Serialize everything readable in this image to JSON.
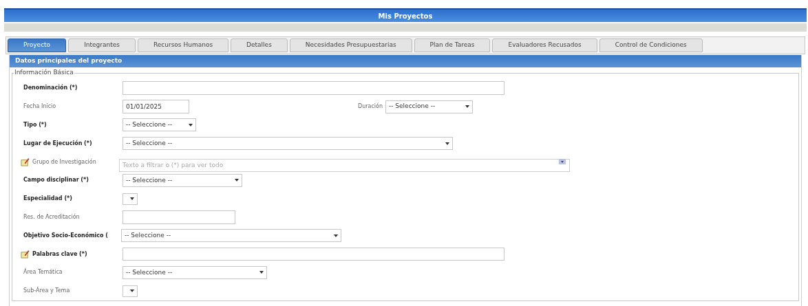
{
  "window": {
    "title": "Mis Proyectos"
  },
  "tabs": [
    {
      "label": "Proyecto",
      "selected": true
    },
    {
      "label": "Integrantes",
      "selected": false
    },
    {
      "label": "Recursos Humanos",
      "selected": false
    },
    {
      "label": "Detalles",
      "selected": false
    },
    {
      "label": "Necesidades Presupuestarias",
      "selected": false
    },
    {
      "label": "Plan de Tareas",
      "selected": false
    },
    {
      "label": "Evaluadores Recusados",
      "selected": false
    },
    {
      "label": "Control de Condiciones",
      "selected": false
    }
  ],
  "section": {
    "title": "Datos principales del proyecto",
    "legend": "Información Básica"
  },
  "fields": [
    {
      "label": "Denominación (*)",
      "required": true,
      "kind": "text"
    },
    {
      "label": "Fecha Inicio",
      "required": false,
      "kind": "text",
      "value": "01/01/2025",
      "side": {
        "label": "Duración",
        "kind": "select",
        "value": "-- Seleccione --"
      }
    },
    {
      "label": "Tipo (*)",
      "required": true,
      "kind": "select",
      "value": "-- Seleccione --"
    },
    {
      "label": "Lugar de Ejecución (*)",
      "required": true,
      "kind": "select",
      "value": "-- Seleccione --"
    },
    {
      "label": "Grupo de Investigación",
      "required": false,
      "kind": "autocomplete",
      "placeholder": "Texto a filtrar o (*) para ver todo",
      "has_icon": true
    },
    {
      "label": "Campo disciplinar (*)",
      "required": true,
      "kind": "select",
      "value": "-- Seleccione --"
    },
    {
      "label": "Especialidad (*)",
      "required": true,
      "kind": "select"
    },
    {
      "label": "Res. de Acreditación",
      "required": false,
      "kind": "text"
    },
    {
      "label": "Objetivo Socio-Económico (",
      "required": true,
      "kind": "select",
      "value": "-- Seleccione --"
    },
    {
      "label": "Palabras clave (*)",
      "required": true,
      "kind": "text",
      "has_icon": true
    },
    {
      "label": "Área Temática",
      "required": false,
      "kind": "select",
      "value": "-- Seleccione --"
    },
    {
      "label": "Sub-Área y Tema",
      "required": false,
      "kind": "select"
    }
  ]
}
